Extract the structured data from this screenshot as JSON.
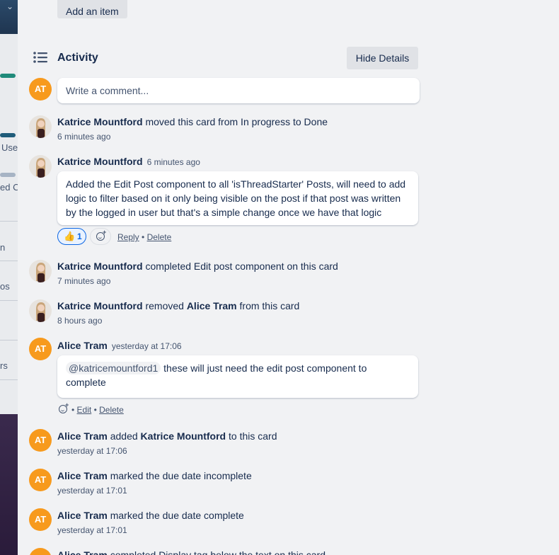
{
  "checklist": {
    "add_item_label": "Add an item"
  },
  "background": {
    "fragments": [
      "Use",
      "ed C",
      "n",
      "os",
      "rs"
    ]
  },
  "activity": {
    "title": "Activity",
    "hide_details_label": "Hide Details",
    "comment_placeholder": "Write a comment...",
    "current_user_initials": "AT"
  },
  "entries": [
    {
      "user": "Katrice Mountford",
      "text": " moved this card from In progress to Done",
      "time": "6 minutes ago"
    },
    {
      "user": "Katrice Mountford",
      "time": "6 minutes ago",
      "comment": "Added the Edit Post component to all 'isThreadStarter' Posts, will need to add logic to filter based on it only being visible on the post if that post was written by the logged in user but that's a simple change once we have that logic",
      "reaction_count": "1",
      "reply_label": "Reply",
      "delete_label": "Delete",
      "separator": "•"
    },
    {
      "user": "Katrice Mountford",
      "text": " completed Edit post component on this card",
      "time": "7 minutes ago"
    },
    {
      "user": "Katrice Mountford",
      "text_a": " removed ",
      "target": "Alice Tram",
      "text_b": " from this card",
      "time": "8 hours ago"
    },
    {
      "user": "Alice Tram",
      "initials": "AT",
      "time": "yesterday at 17:06",
      "mention": "@katricemountford1",
      "comment": " these will just need the edit post component to complete",
      "edit_label": "Edit",
      "delete_label": "Delete",
      "separator": "•"
    },
    {
      "user": "Alice Tram",
      "initials": "AT",
      "text_a": " added ",
      "target": "Katrice Mountford",
      "text_b": " to this card",
      "time": "yesterday at 17:06"
    },
    {
      "user": "Alice Tram",
      "initials": "AT",
      "text": " marked the due date incomplete",
      "time": "yesterday at 17:01"
    },
    {
      "user": "Alice Tram",
      "initials": "AT",
      "text": " marked the due date complete",
      "time": "yesterday at 17:01"
    },
    {
      "user": "Alice Tram",
      "initials": "AT",
      "text": " completed Display tag below the text on this card"
    }
  ],
  "colors": {
    "avatar_orange": "#f79a1d",
    "text": "#172b4d",
    "muted": "#44546f",
    "link_blue": "#0c66e4"
  }
}
